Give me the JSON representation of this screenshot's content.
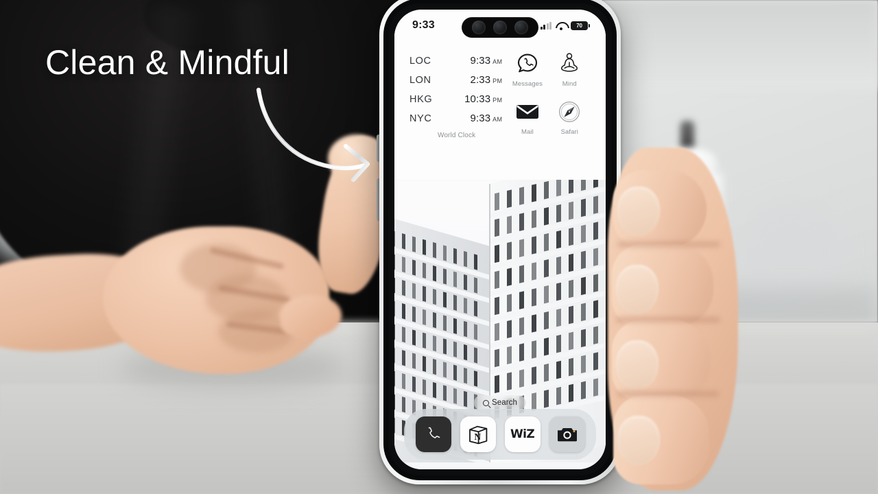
{
  "overlay": {
    "headline": "Clean & Mindful",
    "arrow_icon": "curved-arrow-icon",
    "headline_color": "#ffffff"
  },
  "phone": {
    "device": "smartphone-in-hand",
    "frame_color": "#e6e7e8",
    "statusbar": {
      "time": "9:33",
      "cellular_icon": "cellular-signal-icon",
      "wifi_icon": "wifi-icon",
      "battery_icon": "battery-icon",
      "battery_level": "70"
    },
    "dynamic_island": {
      "label": "dynamic-island",
      "lens_count": 3
    },
    "widgets": {
      "world_clock": {
        "caption": "World Clock",
        "rows": [
          {
            "zone": "LOC",
            "time": "9:33",
            "meridiem": "AM"
          },
          {
            "zone": "LON",
            "time": "2:33",
            "meridiem": "PM"
          },
          {
            "zone": "HKG",
            "time": "10:33",
            "meridiem": "PM"
          },
          {
            "zone": "NYC",
            "time": "9:33",
            "meridiem": "AM"
          }
        ]
      },
      "apps": [
        {
          "label": "Messages",
          "icon": "whatsapp-messages-icon"
        },
        {
          "label": "Mind",
          "icon": "meditation-lotus-icon"
        },
        {
          "label": "Mail",
          "icon": "envelope-mail-icon"
        },
        {
          "label": "Safari",
          "icon": "compass-safari-icon"
        }
      ]
    },
    "search": {
      "label": "Search",
      "icon": "search-icon"
    },
    "dock": [
      {
        "label": "Phone",
        "icon": "phone-handset-icon",
        "bg": "#2e2e2e"
      },
      {
        "label": "Notion",
        "icon": "notion-cube-icon",
        "bg": "#fdfdfd"
      },
      {
        "label": "WiZ",
        "icon": "wiz-wordmark-icon",
        "bg": "#fdfdfd",
        "text": "WiZ"
      },
      {
        "label": "Camera",
        "icon": "camera-icon",
        "bg": "#cfd3d6"
      }
    ],
    "wallpaper": {
      "subject": "modern-white-office-building",
      "sky_color": "#fbfcfd"
    }
  },
  "scene": {
    "background": "blurred-interior-room",
    "surface": "gray-table",
    "subject_clothing": "black-shirt",
    "left_hand": "resting-fist",
    "right_hand": "hand-holding-phone"
  }
}
